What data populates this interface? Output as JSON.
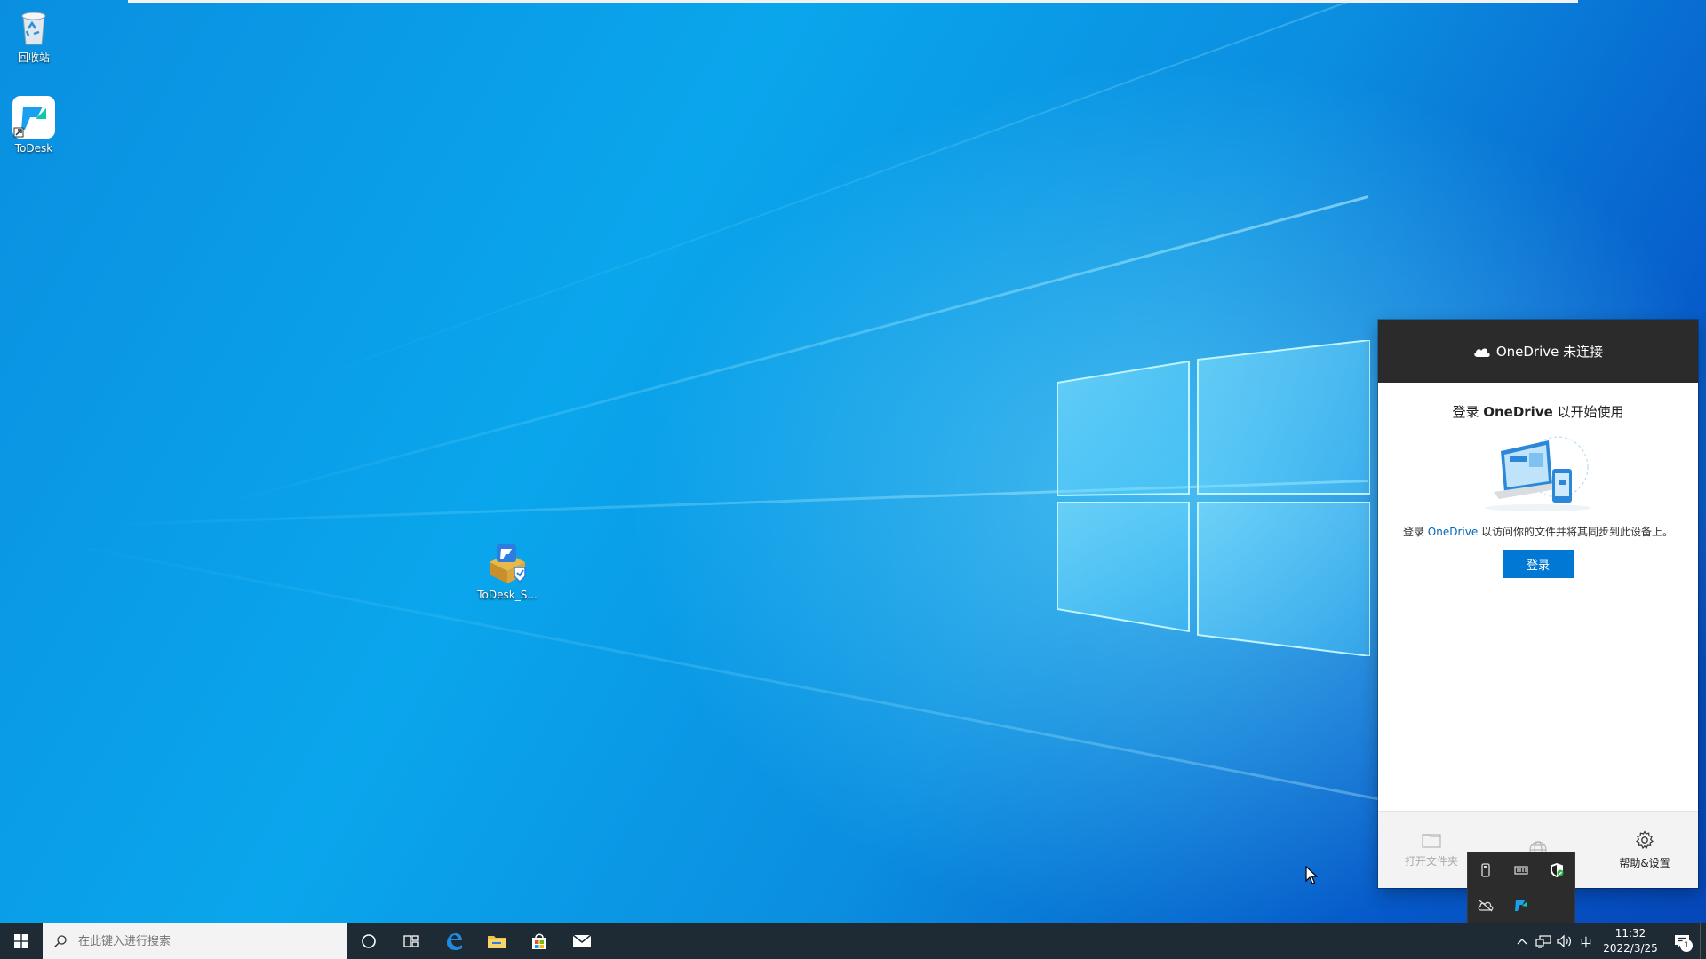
{
  "desktop": {
    "icons": [
      {
        "label": "回收站",
        "icon": "recycle-bin-icon"
      },
      {
        "label": "ToDesk",
        "icon": "todesk-icon"
      },
      {
        "label": "ToDesk_S...",
        "icon": "todesk-setup-icon"
      }
    ]
  },
  "onedrive": {
    "header_title": "OneDrive 未连接",
    "signin_title_pre": "登录 ",
    "signin_title_brand": "OneDrive",
    "signin_title_post": " 以开始使用",
    "desc_pre": "登录 ",
    "desc_brand": "OneDrive",
    "desc_post": " 以访问你的文件并将其同步到此设备上。",
    "signin_button": "登录",
    "footer": {
      "open_folder": "打开文件夹",
      "help_settings": "帮助&设置"
    }
  },
  "tray_overflow": {
    "icons": [
      "usb-icon",
      "memory-icon",
      "security-shield-icon",
      "onedrive-offline-icon",
      "todesk-tray-icon"
    ]
  },
  "taskbar": {
    "search_placeholder": "在此键入进行搜索",
    "apps": [
      "cortana-icon",
      "task-view-icon",
      "edge-icon",
      "file-explorer-icon",
      "store-icon",
      "mail-icon"
    ],
    "ime": "中",
    "time": "11:32",
    "date": "2022/3/25",
    "notification_count": "1"
  },
  "colors": {
    "accent": "#0078d4",
    "taskbar": "#1e2a34",
    "onedrive_header": "#2b2b2b"
  }
}
